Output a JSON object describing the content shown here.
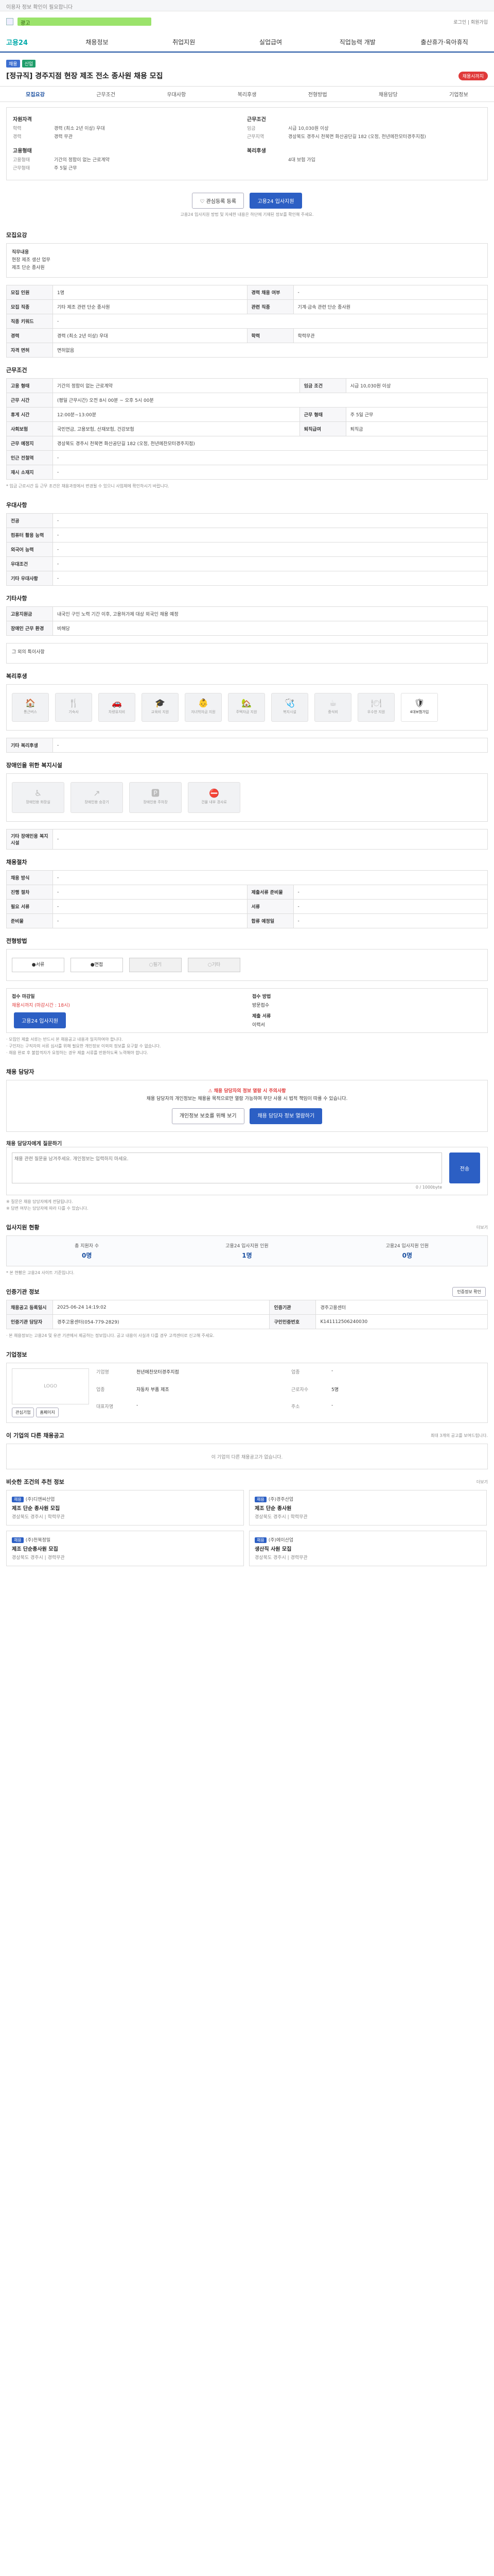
{
  "topbar": {
    "text": "이용자 정보 확인이 필요합니다"
  },
  "notice": {
    "text": "광고",
    "util": "로그인 | 회원가입"
  },
  "gnb": {
    "logo": "고용24",
    "logo_sub": "",
    "menus": [
      "채용정보",
      "취업지원",
      "실업급여",
      "직업능력 개발",
      "출산휴가·육아휴직"
    ]
  },
  "header": {
    "tags": [
      "채용",
      "신입"
    ],
    "title": "[정규직] 경주지점 현장 제조 전소 종사원 채용 모집",
    "dday": "채용시까지"
  },
  "tabs": [
    "모집요강",
    "근무조건",
    "우대사항",
    "복리후생",
    "전형방법",
    "채용담당",
    "기업정보"
  ],
  "summary": {
    "left_hd": "자원자격",
    "left_rows": [
      [
        "학력",
        "경력 (최소 2년 이상) 우대"
      ],
      [
        "경력",
        "경력 무관"
      ]
    ],
    "left_hd2": "고용형태",
    "left_rows2": [
      [
        "고용형태",
        "기간의 정함이 없는 근로계약"
      ],
      [
        "근무형태",
        "주 5일 근무"
      ]
    ],
    "right_hd": "근무조건",
    "right_rows": [
      [
        "임금",
        "시급 10,030원 이상"
      ],
      [
        "근무지역",
        "경상북도 경주시 천북면 화산공단길 182 (오정, 천년에찬모터경주지점)"
      ]
    ],
    "right_hd2": "복리후생",
    "right_rows2": [
      [
        "",
        "4대 보험 가입"
      ]
    ]
  },
  "actions": {
    "save": "관심등록 등록",
    "apply": "고용24 입사지원",
    "note": "고용24 입사지원 방법 및 자세한 내용은 하단에 기재된 정보를 확인해 주세요."
  },
  "sec_qual": {
    "title": "모집요강",
    "sub": "직무내용",
    "body": [
      "현장 제조 생산 업무",
      "제조 단순 종사원"
    ]
  },
  "qual_table": [
    [
      "모집 인원",
      "1명",
      "경력 채용 여부",
      "-"
    ],
    [
      "모집 직종",
      "기타 제조 관련 단순 종사원",
      "관련 직종",
      "기계·금속 관련 단순 종사원"
    ],
    [
      "직종 키워드",
      "-",
      "",
      ""
    ],
    [
      "경력",
      "경력 (최소 2년 이상) 우대",
      "학력",
      "학력무관"
    ],
    [
      "자격 면허",
      "면허없음",
      "",
      ""
    ]
  ],
  "sec_cond": {
    "title": "근무조건"
  },
  "cond_table": [
    [
      "고용 형태",
      "기간의 정함이 없는 근로계약",
      "임금 조건",
      "시급 10,030원 이상"
    ],
    [
      "근무 시간",
      "(평일 근무시간) 오전 8시 00분 ~ 오후 5시 00분",
      "",
      ""
    ],
    [
      "휴게 시간",
      "12:00분~13:00분",
      "근무 형태",
      "주 5일 근무"
    ],
    [
      "사회보험",
      "국민연금, 고용보험, 산재보험, 건강보험",
      "퇴직급여",
      "퇴직금"
    ],
    [
      "근무 예정지",
      "경상북도 경주시 천북면 화산공단길 182 (오정, 천년에찬모터경주지점)",
      "",
      ""
    ],
    [
      "인근 전철역",
      "-",
      "",
      ""
    ],
    [
      "재시 소재지",
      "-",
      "",
      ""
    ]
  ],
  "cond_note": "* 임금 근로시간 등 근무 조건은 채용과정에서 변경될 수 있으니 사업체에 확인하시기 바랍니다.",
  "sec_pref": {
    "title": "우대사항"
  },
  "pref_table": [
    [
      "전공",
      "-"
    ],
    [
      "컴퓨터 활용 능력",
      "-"
    ],
    [
      "외국어 능력",
      "-"
    ],
    [
      "우대조건",
      "-"
    ],
    [
      "기타 우대사항",
      "-"
    ]
  ],
  "sec_etc": {
    "title": "기타사항"
  },
  "etc_table": [
    [
      "고용지원금",
      "내국인 구인 노력 기간 이후, 고용허가제 대상 외국인 채용 예정"
    ],
    [
      "장애인 근무 환경",
      "비해당"
    ]
  ],
  "etc_box": "그 외의 특이사항",
  "sec_welfare": {
    "title": "복리후생"
  },
  "welfare_icons": [
    {
      "sym": "🏠",
      "label": "통근버스",
      "on": false
    },
    {
      "sym": "🍴",
      "label": "기숙사",
      "on": false
    },
    {
      "sym": "🚗",
      "label": "차량유지비",
      "on": false
    },
    {
      "sym": "🎓",
      "label": "교육비 지원",
      "on": false
    },
    {
      "sym": "👶",
      "label": "자녀학자금 지원",
      "on": false
    },
    {
      "sym": "🏡",
      "label": "주택자금 지원",
      "on": false
    },
    {
      "sym": "🩺",
      "label": "복지시설",
      "on": false
    },
    {
      "sym": "☕",
      "label": "중식비",
      "on": false
    },
    {
      "sym": "🍽",
      "label": "우수한 지원",
      "on": false
    },
    {
      "sym": "🛡",
      "label": "4대보험가입",
      "on": true
    }
  ],
  "welfare_etc": {
    "label": "기타 복리후생",
    "value": "-"
  },
  "sec_disab": {
    "title": "장애인을 위한 복지시설"
  },
  "disab_icons": [
    {
      "sym": "♿",
      "label": "장애인용 화장실"
    },
    {
      "sym": "↗",
      "label": "장애인용 승강기"
    },
    {
      "sym": "🅿",
      "label": "장애인용 주차장"
    },
    {
      "sym": "⛔",
      "label": "건물 내부 경사로"
    }
  ],
  "disab_etc": {
    "label": "기타 장애인용 복지시설",
    "value": "-"
  },
  "sec_cert": {
    "title": "채용절차"
  },
  "cert_table": [
    [
      "채용 방식",
      "-",
      "",
      ""
    ],
    [
      "진행 절차",
      "-",
      "제출서류 준비물",
      "-"
    ],
    [
      "필요 서류",
      "-",
      "서류",
      "-"
    ],
    [
      "준비물",
      "-",
      "합류 예정일",
      "-"
    ]
  ],
  "sec_method": {
    "title": "전형방법"
  },
  "method_opts": [
    {
      "label": "서류",
      "on": true
    },
    {
      "label": "면접",
      "on": true
    },
    {
      "label": "필기",
      "on": false
    },
    {
      "label": "기타",
      "on": false
    }
  ],
  "apply_info": {
    "hd1": "접수 마감일",
    "deadline_label": "채용시까지 (마감시간 : 18시)",
    "hd2": "접수 방법",
    "method": "방문접수",
    "btn": "고용24 입사지원",
    "hd3": "제출 서류",
    "docs": "이력서"
  },
  "apply_notes": [
    "· 모집인 제출 서류는 반드시 본 채용공고 내용과 일치하여야 합니다.",
    "· 구인자는 구직자의 서류 심사를 위해 필요한 개인정보 이외의 정보를 요구할 수 없습니다.",
    "· 채용 완료 후 불합격자가 요청하는 경우 제출 서류를 반환하도록 노력해야 합니다."
  ],
  "sec_contact": {
    "title": "채용 담당자"
  },
  "contact_alert": {
    "title": "채용 담당자의 정보 열람 시 주의사항",
    "body": "채용 담당자의 개인정보는 채용을 목적으로만 열람 가능하며 무단 사용 시 법적 책임이 따를 수 있습니다.",
    "btn1": "개인정보 보호를 위해 보기",
    "btn2": "채용 담당자 정보 열람하기"
  },
  "question": {
    "title": "채용 담당자에게 질문하기",
    "placeholder": "채용 관련 질문을 남겨주세요. 개인정보는 입력하지 마세요.",
    "count": "0 / 1000byte",
    "btn": "전송",
    "notes": [
      "※ 질문은 채용 담당자에게 전달됩니다.",
      "※ 답변 여부는 담당자에 따라 다를 수 있습니다."
    ]
  },
  "sec_stat": {
    "title": "입사지원 현황",
    "more": "더보기"
  },
  "stats": [
    {
      "label": "총 지원자 수",
      "value": "0명"
    },
    {
      "label": "고용24 입사지원 인원",
      "value": "1명"
    },
    {
      "label": "고용24 입사지원 인원",
      "value": "0명"
    }
  ],
  "stat_note": "* 본 현황은 고용24 사이트 기준입니다.",
  "sec_info": {
    "title": "인증기관 정보",
    "btn": "인증정보 확인"
  },
  "info_table": [
    [
      "채용공고 등록일시",
      "2025-06-24 14:19:02",
      "인증기관",
      "경주고용센터"
    ],
    [
      "인증기관 담당자",
      "경주고용센터(054-779-2829)",
      "구인인증번호",
      "K141112506240030"
    ]
  ],
  "info_note": "· 본 채용정보는 고용24 및 유관 기관에서 제공하는 정보입니다. 공고 내용이 사실과 다를 경우 고객센터로 신고해 주세요.",
  "sec_company": {
    "title": "기업정보"
  },
  "company": {
    "logo": "LOGO",
    "btn1": "관심기업",
    "btn2": "홈페이지",
    "rows": [
      [
        "기업명",
        "천년에찬모터경주지점",
        "업종",
        "-"
      ],
      [
        "업종",
        "자동차 부품 제조",
        "근로자수",
        "5명"
      ],
      [
        "대표자명",
        "-",
        "주소",
        "-"
      ]
    ]
  },
  "sec_other": {
    "title": "이 기업의 다른 채용공고",
    "note": "최대 3개의 공고를 보여드립니다."
  },
  "other_empty": "이 기업의 다른 채용공고가 없습니다.",
  "sec_similar": {
    "title": "비슷한 조건의 추천 정보",
    "more": "더보기"
  },
  "similar_cards": [
    {
      "co": "(주)디앤씨산업",
      "title": "제조 단순 종사원 모집",
      "meta": "경상북도 경주시 | 학력무관"
    },
    {
      "co": "(주)경주산업",
      "title": "제조 단순 종사원",
      "meta": "경상북도 경주시 | 학력무관"
    },
    {
      "co": "(주)천북정밀",
      "title": "제조 단순종사원 모집",
      "meta": "경상북도 경주시 | 경력무관"
    },
    {
      "co": "(주)에이산업",
      "title": "생산직 사원 모집",
      "meta": "경상북도 경주시 | 경력무관"
    }
  ]
}
